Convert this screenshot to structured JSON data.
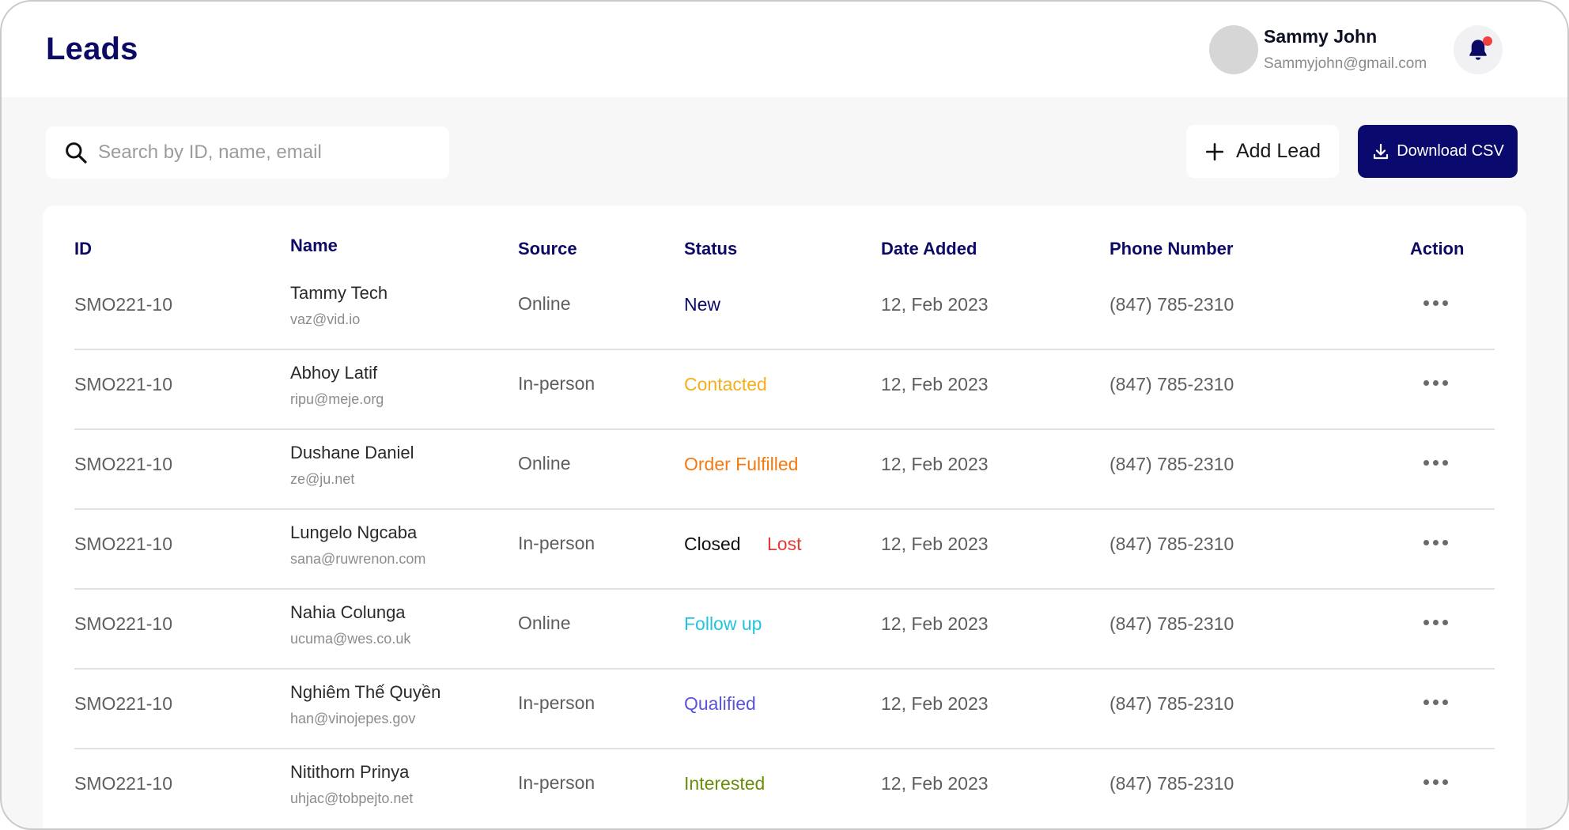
{
  "header": {
    "title": "Leads",
    "user_name": "Sammy John",
    "user_email": "Sammyjohn@gmail.com",
    "notification_icon": "bell-icon",
    "notification_dot_color": "#f04141"
  },
  "toolbar": {
    "search_placeholder": "Search by ID, name, email",
    "search_value": "",
    "add_label": "Add Lead",
    "download_label": "Download CSV",
    "accent_color": "#0a0a6e"
  },
  "table": {
    "columns": [
      "ID",
      "Name",
      "Source",
      "Status",
      "Date Added",
      "Phone Number",
      "Action"
    ],
    "rows": [
      {
        "id": "SMO221-10",
        "name": "Tammy Tech",
        "email": "vaz@vid.io",
        "source": "Online",
        "status": "New",
        "status_extra": "",
        "status_color": "#0d0a66",
        "date": "12, Feb 2023",
        "phone": "(847) 785-2310"
      },
      {
        "id": "SMO221-10",
        "name": "Abhoy Latif",
        "email": "ripu@meje.org",
        "source": "In-person",
        "status": "Contacted",
        "status_extra": "",
        "status_color": "#f2b01e",
        "date": "12, Feb 2023",
        "phone": "(847) 785-2310"
      },
      {
        "id": "SMO221-10",
        "name": "Dushane Daniel",
        "email": "ze@ju.net",
        "source": "Online",
        "status": "Order Fulfilled",
        "status_extra": "",
        "status_color": "#f47a10",
        "date": "12, Feb 2023",
        "phone": "(847) 785-2310"
      },
      {
        "id": "SMO221-10",
        "name": "Lungelo Ngcaba",
        "email": "sana@ruwrenon.com",
        "source": "In-person",
        "status": "Closed",
        "status_extra": "Lost",
        "status_color": "#111111",
        "status_extra_color": "#e53935",
        "date": "12, Feb 2023",
        "phone": "(847) 785-2310"
      },
      {
        "id": "SMO221-10",
        "name": "Nahia Colunga",
        "email": "ucuma@wes.co.uk",
        "source": "Online",
        "status": "Follow up",
        "status_extra": "",
        "status_color": "#22c4dc",
        "date": "12, Feb 2023",
        "phone": "(847) 785-2310"
      },
      {
        "id": "SMO221-10",
        "name": "Nghiêm Thế Quyền",
        "email": "han@vinojepes.gov",
        "source": "In-person",
        "status": "Qualified",
        "status_extra": "",
        "status_color": "#5a55d6",
        "date": "12, Feb 2023",
        "phone": "(847) 785-2310"
      },
      {
        "id": "SMO221-10",
        "name": "Nitithorn Prinya",
        "email": "uhjac@tobpejto.net",
        "source": "In-person",
        "status": "Interested",
        "status_extra": "",
        "status_color": "#6b8e0a",
        "date": "12, Feb 2023",
        "phone": "(847) 785-2310"
      }
    ],
    "action_icon": "more-horizontal-icon"
  }
}
